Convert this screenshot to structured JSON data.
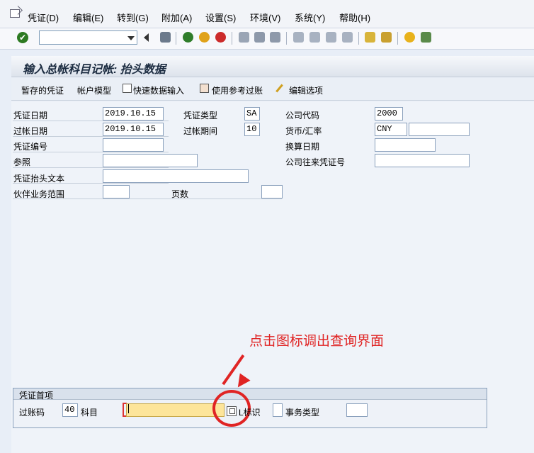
{
  "menu": {
    "items": [
      "凭证(D)",
      "编辑(E)",
      "转到(G)",
      "附加(A)",
      "设置(S)",
      "环境(V)",
      "系统(Y)",
      "帮助(H)"
    ]
  },
  "toolbar": {
    "command_field_value": "",
    "icons": [
      "enter-icon",
      "save-icon",
      "back-icon",
      "exit-icon",
      "cancel-icon",
      "print-icon",
      "find-icon",
      "find-next-icon",
      "first-page-icon",
      "prev-page-icon",
      "next-page-icon",
      "last-page-icon",
      "new-session-icon",
      "shortcut-icon",
      "help-icon",
      "layout-icon"
    ]
  },
  "title": "输入总帐科目记帐: 抬头数据",
  "app_toolbar": {
    "held_doc": "暂存的凭证",
    "acct_model": "帐户模型",
    "fast_entry": "快速数据输入",
    "post_ref": "使用参考过账",
    "edit_options": "编辑选项"
  },
  "header": {
    "doc_date_label": "凭证日期",
    "doc_date": "2019.10.15",
    "doc_type_label": "凭证类型",
    "doc_type": "SA",
    "company_code_label": "公司代码",
    "company_code": "2000",
    "posting_date_label": "过帐日期",
    "posting_date": "2019.10.15",
    "period_label": "过帐期间",
    "period": "10",
    "currency_label": "货币/汇率",
    "currency": "CNY",
    "exchange_rate": "",
    "doc_number_label": "凭证编号",
    "doc_number": "",
    "translation_date_label": "换算日期",
    "translation_date": "",
    "reference_label": "参照",
    "reference": "",
    "cross_cc_label": "公司往来凭证号",
    "cross_cc": "",
    "header_text_label": "凭证抬头文本",
    "header_text": "",
    "partner_ba_label": "伙伴业务范围",
    "partner_ba": "",
    "pages_label": "页数",
    "pages": ""
  },
  "first_item": {
    "group_title": "凭证首项",
    "posting_key_label": "过账码",
    "posting_key": "40",
    "account_label": "科目",
    "account": "",
    "special_gl_label": "L标识",
    "special_gl": "",
    "trans_type_label": "事务类型",
    "trans_type": ""
  },
  "annotation": "点击图标调出查询界面",
  "colors": {
    "accent_red": "#e02424",
    "required_yellow": "#fde59a"
  }
}
